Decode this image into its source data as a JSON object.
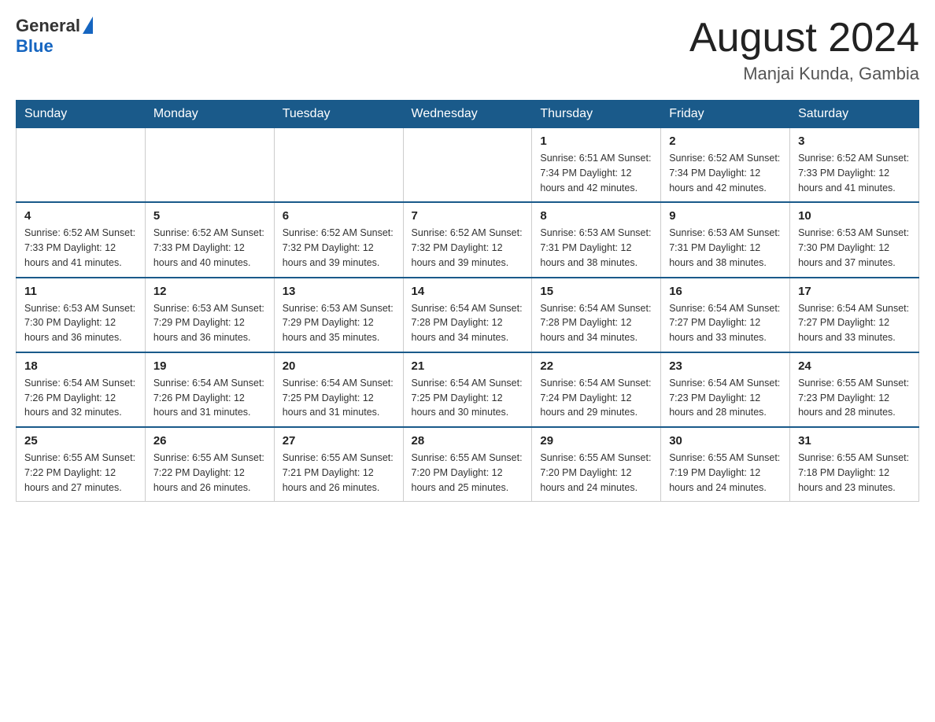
{
  "header": {
    "logo": {
      "text_general": "General",
      "text_blue": "Blue"
    },
    "title": "August 2024",
    "subtitle": "Manjai Kunda, Gambia"
  },
  "calendar": {
    "days_of_week": [
      "Sunday",
      "Monday",
      "Tuesday",
      "Wednesday",
      "Thursday",
      "Friday",
      "Saturday"
    ],
    "weeks": [
      [
        {
          "day": "",
          "info": ""
        },
        {
          "day": "",
          "info": ""
        },
        {
          "day": "",
          "info": ""
        },
        {
          "day": "",
          "info": ""
        },
        {
          "day": "1",
          "info": "Sunrise: 6:51 AM\nSunset: 7:34 PM\nDaylight: 12 hours\nand 42 minutes."
        },
        {
          "day": "2",
          "info": "Sunrise: 6:52 AM\nSunset: 7:34 PM\nDaylight: 12 hours\nand 42 minutes."
        },
        {
          "day": "3",
          "info": "Sunrise: 6:52 AM\nSunset: 7:33 PM\nDaylight: 12 hours\nand 41 minutes."
        }
      ],
      [
        {
          "day": "4",
          "info": "Sunrise: 6:52 AM\nSunset: 7:33 PM\nDaylight: 12 hours\nand 41 minutes."
        },
        {
          "day": "5",
          "info": "Sunrise: 6:52 AM\nSunset: 7:33 PM\nDaylight: 12 hours\nand 40 minutes."
        },
        {
          "day": "6",
          "info": "Sunrise: 6:52 AM\nSunset: 7:32 PM\nDaylight: 12 hours\nand 39 minutes."
        },
        {
          "day": "7",
          "info": "Sunrise: 6:52 AM\nSunset: 7:32 PM\nDaylight: 12 hours\nand 39 minutes."
        },
        {
          "day": "8",
          "info": "Sunrise: 6:53 AM\nSunset: 7:31 PM\nDaylight: 12 hours\nand 38 minutes."
        },
        {
          "day": "9",
          "info": "Sunrise: 6:53 AM\nSunset: 7:31 PM\nDaylight: 12 hours\nand 38 minutes."
        },
        {
          "day": "10",
          "info": "Sunrise: 6:53 AM\nSunset: 7:30 PM\nDaylight: 12 hours\nand 37 minutes."
        }
      ],
      [
        {
          "day": "11",
          "info": "Sunrise: 6:53 AM\nSunset: 7:30 PM\nDaylight: 12 hours\nand 36 minutes."
        },
        {
          "day": "12",
          "info": "Sunrise: 6:53 AM\nSunset: 7:29 PM\nDaylight: 12 hours\nand 36 minutes."
        },
        {
          "day": "13",
          "info": "Sunrise: 6:53 AM\nSunset: 7:29 PM\nDaylight: 12 hours\nand 35 minutes."
        },
        {
          "day": "14",
          "info": "Sunrise: 6:54 AM\nSunset: 7:28 PM\nDaylight: 12 hours\nand 34 minutes."
        },
        {
          "day": "15",
          "info": "Sunrise: 6:54 AM\nSunset: 7:28 PM\nDaylight: 12 hours\nand 34 minutes."
        },
        {
          "day": "16",
          "info": "Sunrise: 6:54 AM\nSunset: 7:27 PM\nDaylight: 12 hours\nand 33 minutes."
        },
        {
          "day": "17",
          "info": "Sunrise: 6:54 AM\nSunset: 7:27 PM\nDaylight: 12 hours\nand 33 minutes."
        }
      ],
      [
        {
          "day": "18",
          "info": "Sunrise: 6:54 AM\nSunset: 7:26 PM\nDaylight: 12 hours\nand 32 minutes."
        },
        {
          "day": "19",
          "info": "Sunrise: 6:54 AM\nSunset: 7:26 PM\nDaylight: 12 hours\nand 31 minutes."
        },
        {
          "day": "20",
          "info": "Sunrise: 6:54 AM\nSunset: 7:25 PM\nDaylight: 12 hours\nand 31 minutes."
        },
        {
          "day": "21",
          "info": "Sunrise: 6:54 AM\nSunset: 7:25 PM\nDaylight: 12 hours\nand 30 minutes."
        },
        {
          "day": "22",
          "info": "Sunrise: 6:54 AM\nSunset: 7:24 PM\nDaylight: 12 hours\nand 29 minutes."
        },
        {
          "day": "23",
          "info": "Sunrise: 6:54 AM\nSunset: 7:23 PM\nDaylight: 12 hours\nand 28 minutes."
        },
        {
          "day": "24",
          "info": "Sunrise: 6:55 AM\nSunset: 7:23 PM\nDaylight: 12 hours\nand 28 minutes."
        }
      ],
      [
        {
          "day": "25",
          "info": "Sunrise: 6:55 AM\nSunset: 7:22 PM\nDaylight: 12 hours\nand 27 minutes."
        },
        {
          "day": "26",
          "info": "Sunrise: 6:55 AM\nSunset: 7:22 PM\nDaylight: 12 hours\nand 26 minutes."
        },
        {
          "day": "27",
          "info": "Sunrise: 6:55 AM\nSunset: 7:21 PM\nDaylight: 12 hours\nand 26 minutes."
        },
        {
          "day": "28",
          "info": "Sunrise: 6:55 AM\nSunset: 7:20 PM\nDaylight: 12 hours\nand 25 minutes."
        },
        {
          "day": "29",
          "info": "Sunrise: 6:55 AM\nSunset: 7:20 PM\nDaylight: 12 hours\nand 24 minutes."
        },
        {
          "day": "30",
          "info": "Sunrise: 6:55 AM\nSunset: 7:19 PM\nDaylight: 12 hours\nand 24 minutes."
        },
        {
          "day": "31",
          "info": "Sunrise: 6:55 AM\nSunset: 7:18 PM\nDaylight: 12 hours\nand 23 minutes."
        }
      ]
    ]
  }
}
